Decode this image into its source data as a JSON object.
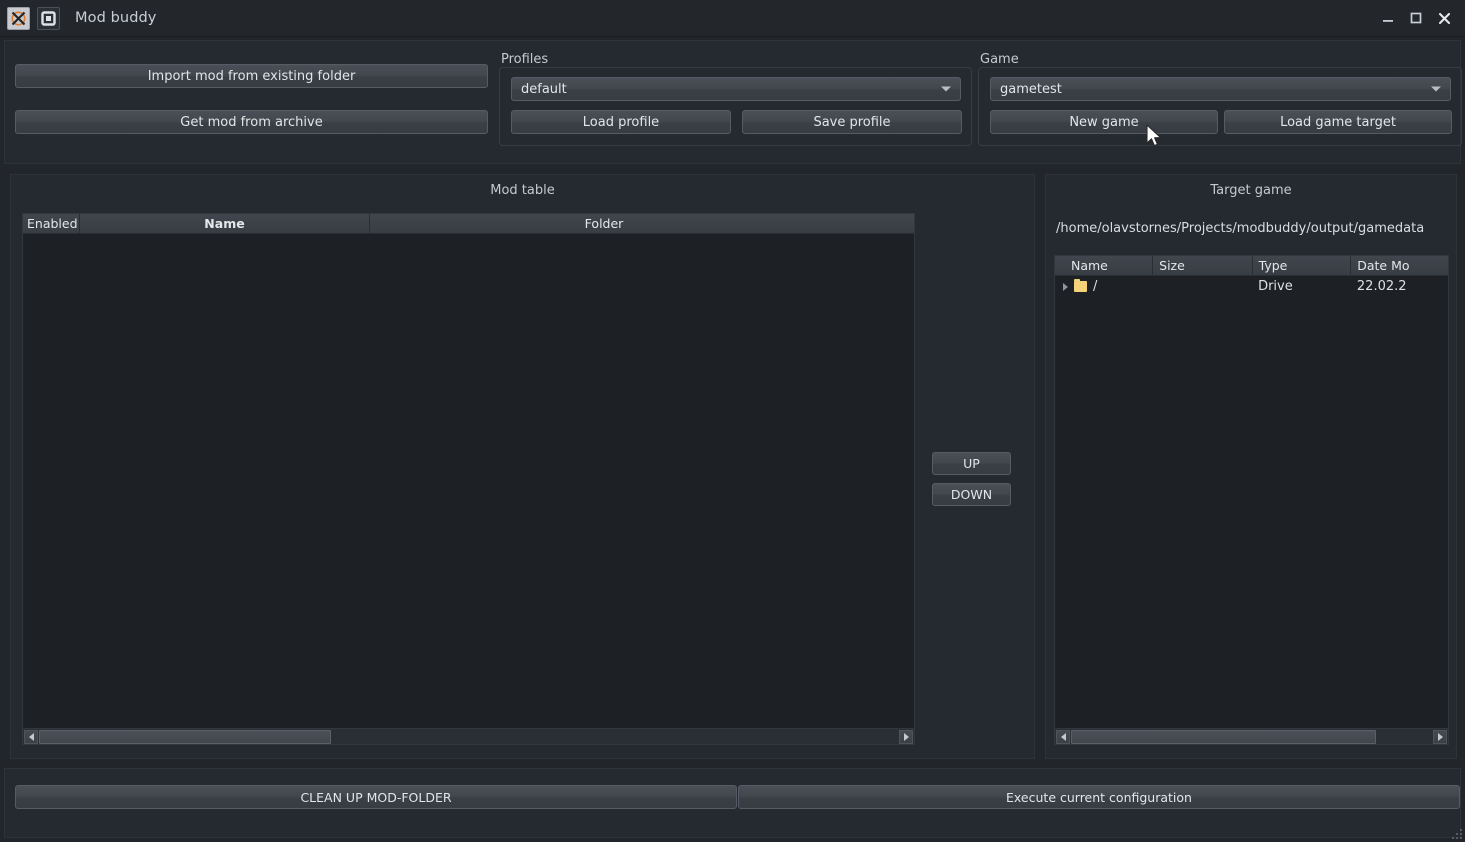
{
  "window": {
    "title": "Mod buddy",
    "icons": {
      "app": "x-app-icon",
      "secondary": "window-shape-icon"
    },
    "controls": {
      "minimize": "minimize-icon",
      "maximize": "maximize-icon",
      "close": "close-icon"
    }
  },
  "toolbar": {
    "import_mod_label": "Import mod from existing folder",
    "get_mod_label": "Get mod from archive"
  },
  "profiles": {
    "group_label": "Profiles",
    "selected": "default",
    "load_label": "Load profile",
    "save_label": "Save profile"
  },
  "game": {
    "group_label": "Game",
    "selected": "gametest",
    "new_game_label": "New game",
    "load_target_label": "Load game target"
  },
  "mod_table": {
    "title": "Mod table",
    "columns": [
      "Enabled",
      "Name",
      "",
      "Folder"
    ],
    "rows": []
  },
  "reorder": {
    "up_label": "UP",
    "down_label": "DOWN"
  },
  "target_game": {
    "title": "Target game",
    "path": "/home/olavstornes/Projects/modbuddy/output/gamedata",
    "columns": [
      "Name",
      "Size",
      "Type",
      "Date Mo"
    ],
    "rows": [
      {
        "name": "/",
        "size": "",
        "type": "Drive",
        "date": "22.02.2"
      }
    ]
  },
  "actions": {
    "cleanup_label": "CLEAN UP MOD-FOLDER",
    "execute_label": "Execute current configuration"
  },
  "colors": {
    "window_bg": "#22262b",
    "panel_bg": "#252a30",
    "list_bg": "#1d2025",
    "button_top": "#4a4f57",
    "button_bottom": "#383c43",
    "header_top": "#41464e",
    "text": "#d6d9dd",
    "folder_icon": "#f4d27a"
  }
}
